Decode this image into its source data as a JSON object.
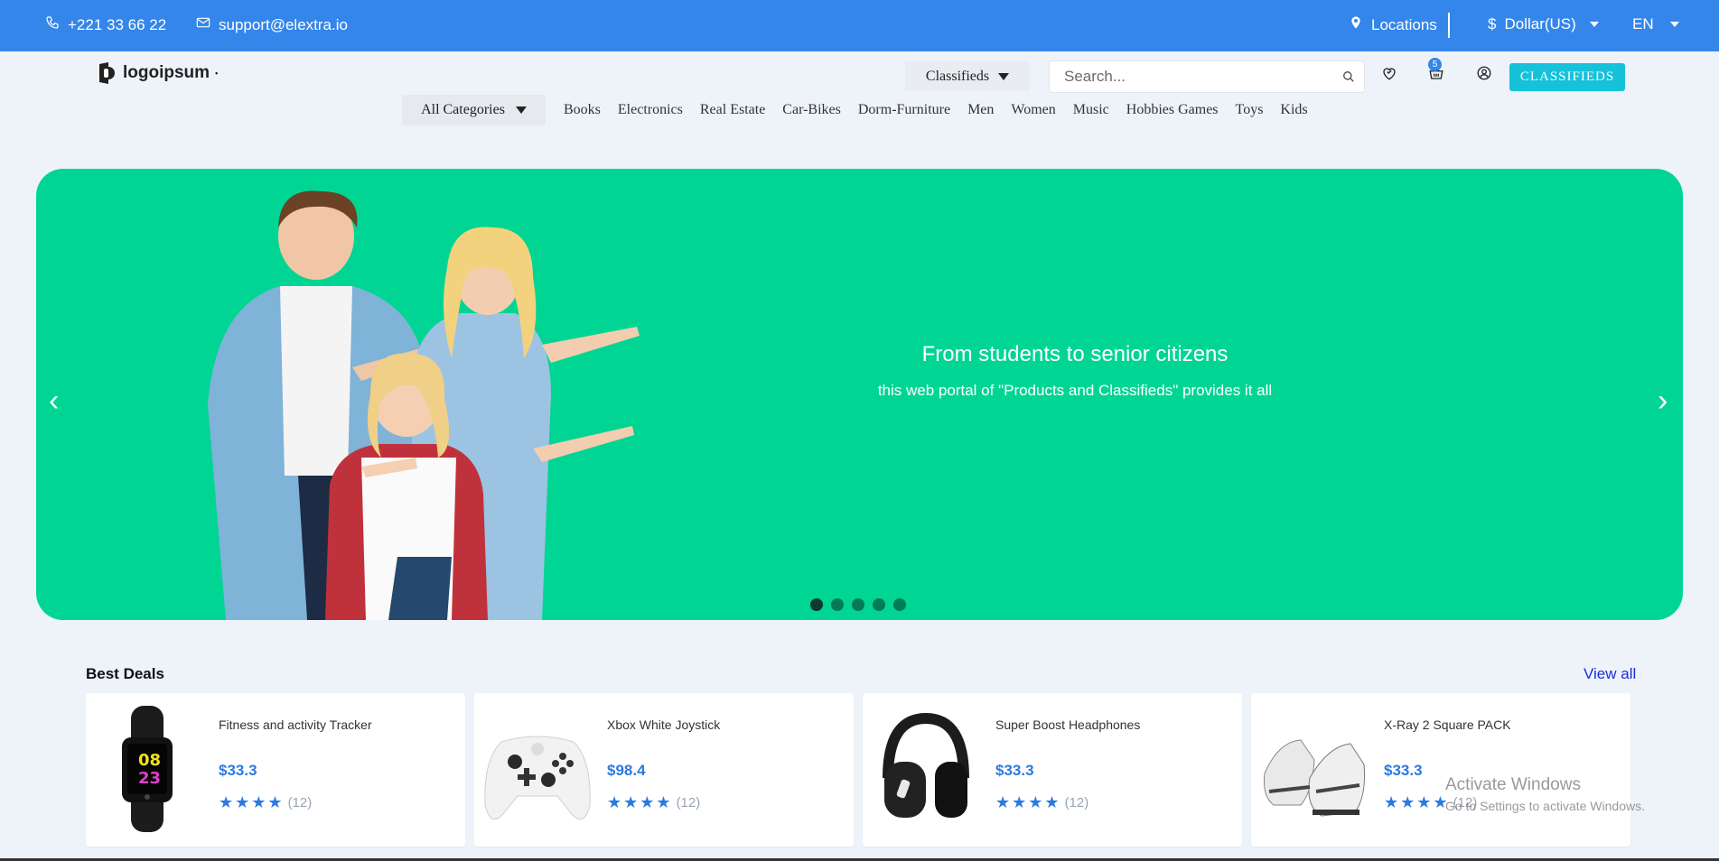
{
  "topbar": {
    "phone": "+221 33 66 22",
    "email": "support@elextra.io",
    "locations": "Locations",
    "currency": "Dollar(US)",
    "language": "EN"
  },
  "header": {
    "logo_text": "logoipsum",
    "classifieds_select": "Classifieds",
    "search_placeholder": "Search...",
    "cart_count": "5",
    "classifieds_button": "CLASSIFIEDS"
  },
  "categories": {
    "all_label": "All Categories",
    "items": [
      "Books",
      "Electronics",
      "Real Estate",
      "Car-Bikes",
      "Dorm-Furniture",
      "Men",
      "Women",
      "Music",
      "Hobbies Games",
      "Toys",
      "Kids"
    ]
  },
  "hero": {
    "title": "From students to senior citizens",
    "subtitle": "this web portal of \"Products and Classifieds\" provides it all",
    "prev": "‹",
    "next": "›",
    "slides": 5,
    "active_slide": 1,
    "bg_color": "#01d593"
  },
  "deals": {
    "title": "Best Deals",
    "view_all": "View all",
    "products": [
      {
        "name": "Fitness and activity Tracker",
        "price": "$33.3",
        "stars": 4,
        "reviews": "(12)"
      },
      {
        "name": "Xbox White Joystick",
        "price": "$98.4",
        "stars": 4,
        "reviews": "(12)"
      },
      {
        "name": "Super Boost Headphones",
        "price": "$33.3",
        "stars": 4,
        "reviews": "(12)"
      },
      {
        "name": "X-Ray 2 Square PACK",
        "price": "$33.3",
        "stars": 4,
        "reviews": "(12)"
      }
    ]
  },
  "watermark": {
    "line1": "Activate Windows",
    "line2": "Go to Settings to activate Windows."
  },
  "colors": {
    "accent": "#3486ea",
    "price": "#2b7ae0",
    "cta": "#15c2d9"
  }
}
